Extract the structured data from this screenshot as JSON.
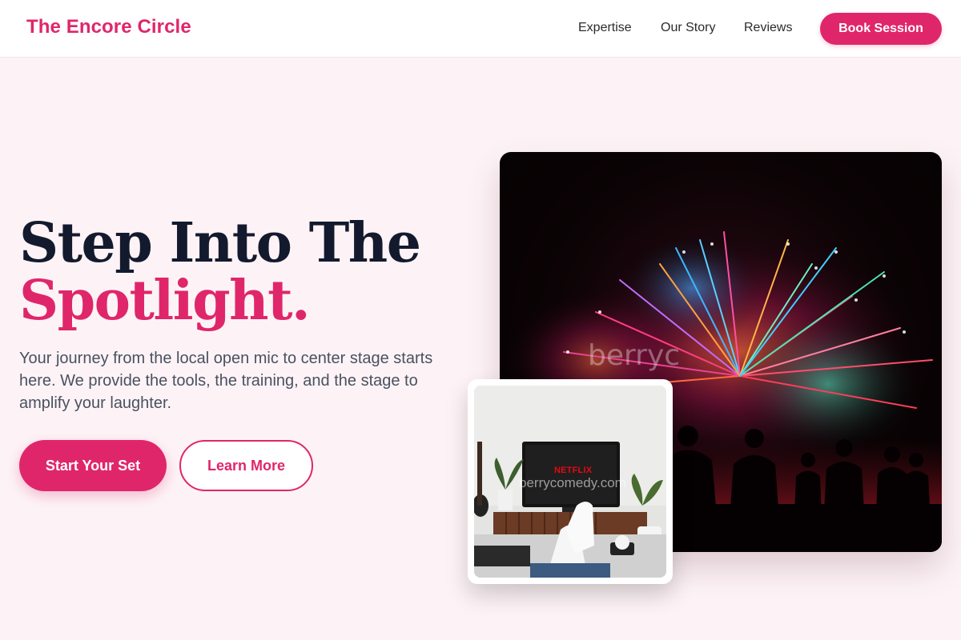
{
  "brand": {
    "name": "The Encore Circle",
    "accent_color": "#e0266a"
  },
  "nav": {
    "links": [
      "Expertise",
      "Our Story",
      "Reviews"
    ],
    "cta": "Book Session"
  },
  "hero": {
    "title_line1": "Step Into The",
    "title_line2": "Spotlight.",
    "subtitle": "Your journey from the local open mic to center stage starts here. We provide the tools, the training, and the stage to amplify your laughter.",
    "primary_button": "Start Your Set",
    "secondary_button": "Learn More"
  },
  "images": {
    "main_watermark": "berryc",
    "card_watermark": "berrycomedy.com",
    "tv_logo_text": "NETFLIX"
  }
}
